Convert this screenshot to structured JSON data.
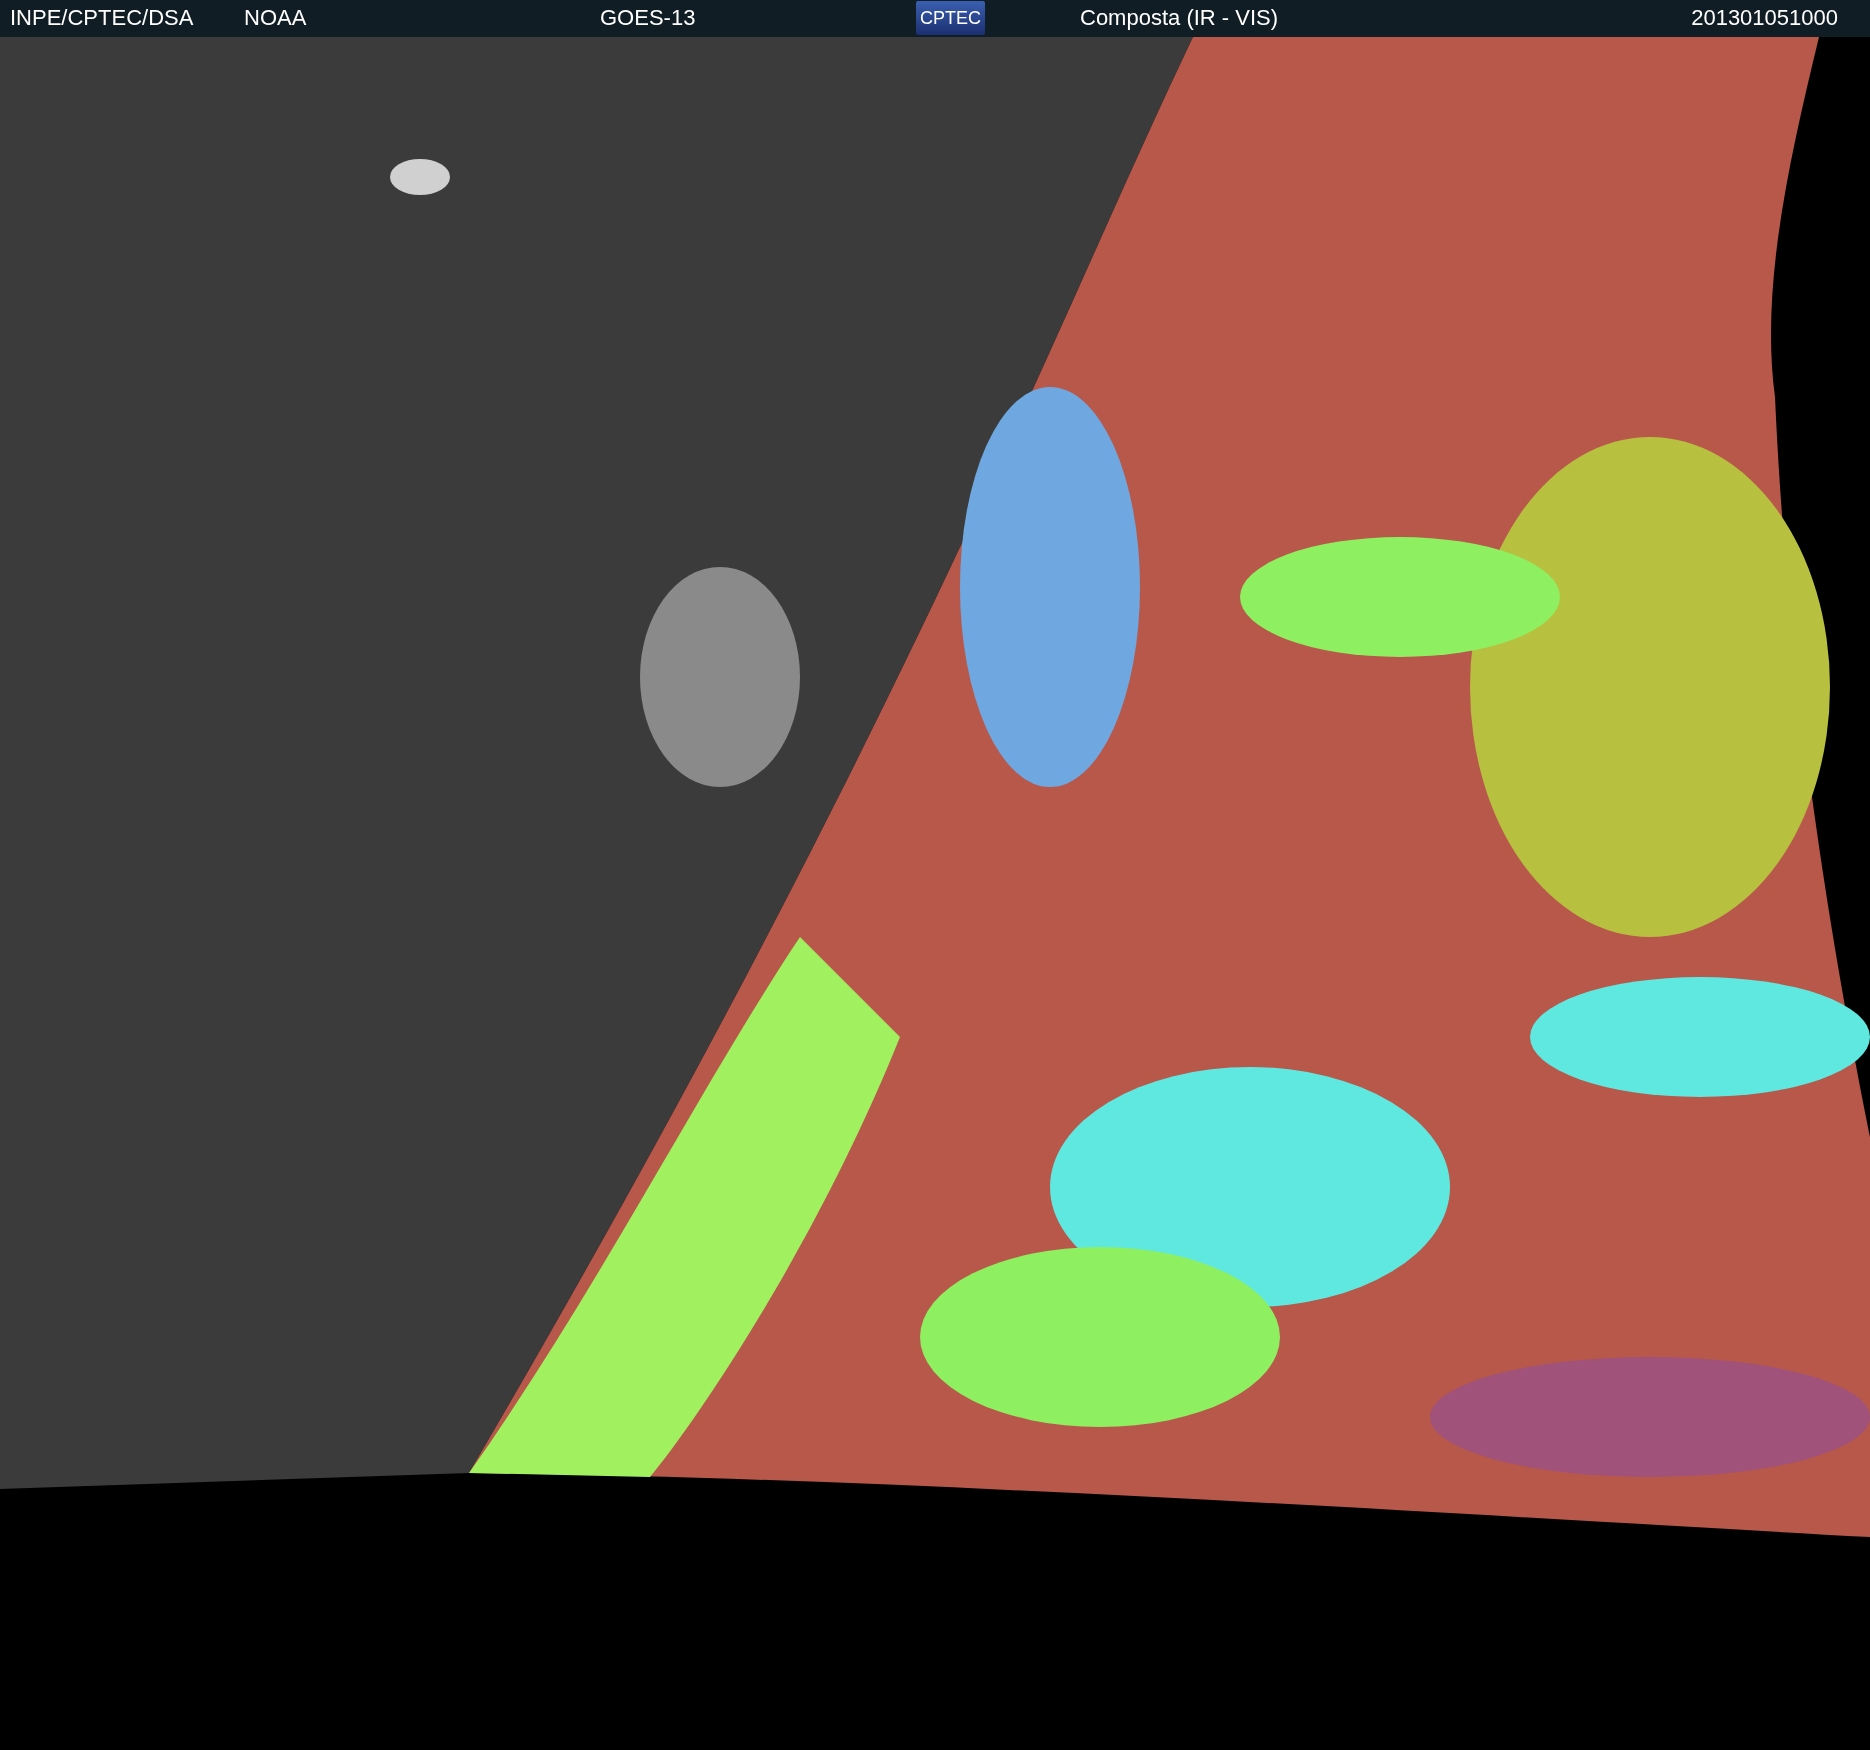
{
  "header": {
    "source": "INPE/CPTEC/DSA",
    "agency": "NOAA",
    "satellite": "GOES-13",
    "logo": "CPTEC",
    "product": "Composta (IR - VIS)",
    "timestamp": "201301051000"
  }
}
